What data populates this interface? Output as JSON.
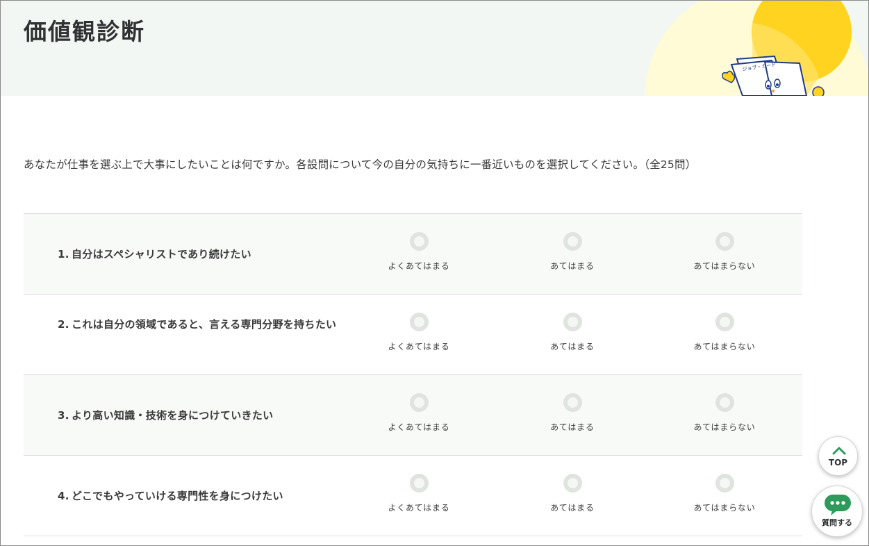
{
  "page": {
    "title": "価値観診断",
    "intro": "あなたが仕事を選ぶ上で大事にしたいことは何ですか。各設問について今の自分の気持ちに一番近いものを選択してください。（全25問）"
  },
  "mascot": {
    "card_text": "ジョブ・カード"
  },
  "options": [
    "よくあてはまる",
    "あてはまる",
    "あてはまらない"
  ],
  "questions": [
    {
      "num": "1.",
      "text": "自分はスペシャリストであり続けたい"
    },
    {
      "num": "2.",
      "text": "これは自分の領域であると、言える専門分野を持ちたい"
    },
    {
      "num": "3.",
      "text": "より高い知識・技術を身につけていきたい"
    },
    {
      "num": "4.",
      "text": "どこでもやっていける専門性を身につけたい"
    }
  ],
  "floating": {
    "top_label": "TOP",
    "ask_label": "質問する"
  },
  "colors": {
    "header_bg": "#f2f7f3",
    "sun": "#ffd320",
    "accent_green": "#2e9a5c",
    "radio": "#dfe4df"
  }
}
